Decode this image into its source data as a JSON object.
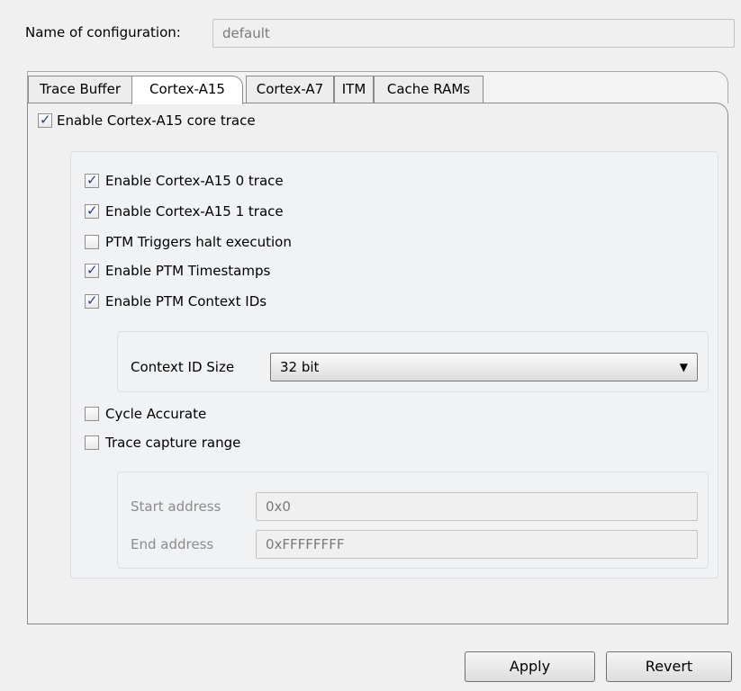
{
  "config": {
    "name_label": "Name of configuration:",
    "name_value": "default"
  },
  "tabs": [
    {
      "label": "Trace Buffer",
      "active": false
    },
    {
      "label": "Cortex-A15",
      "active": true
    },
    {
      "label": "Cortex-A7",
      "active": false
    },
    {
      "label": "ITM",
      "active": false
    },
    {
      "label": "Cache RAMs",
      "active": false
    }
  ],
  "core_trace": {
    "label": "Enable Cortex-A15 core trace",
    "checked": true
  },
  "options": [
    {
      "label": "Enable Cortex-A15 0 trace",
      "checked": true
    },
    {
      "label": "Enable Cortex-A15 1 trace",
      "checked": true
    },
    {
      "label": "PTM Triggers halt execution",
      "checked": false
    },
    {
      "label": "Enable PTM Timestamps",
      "checked": true
    },
    {
      "label": "Enable PTM Context IDs",
      "checked": true
    }
  ],
  "context_id": {
    "label": "Context ID Size",
    "value": "32 bit"
  },
  "cycle_accurate": {
    "label": "Cycle Accurate",
    "checked": false
  },
  "trace_range": {
    "label": "Trace capture range",
    "checked": false,
    "start_label": "Start address",
    "start_value": "0x0",
    "end_label": "End address",
    "end_value": "0xFFFFFFFF"
  },
  "buttons": {
    "apply": "Apply",
    "revert": "Revert"
  },
  "icons": {
    "check": "✓",
    "dropdown": "▼"
  }
}
